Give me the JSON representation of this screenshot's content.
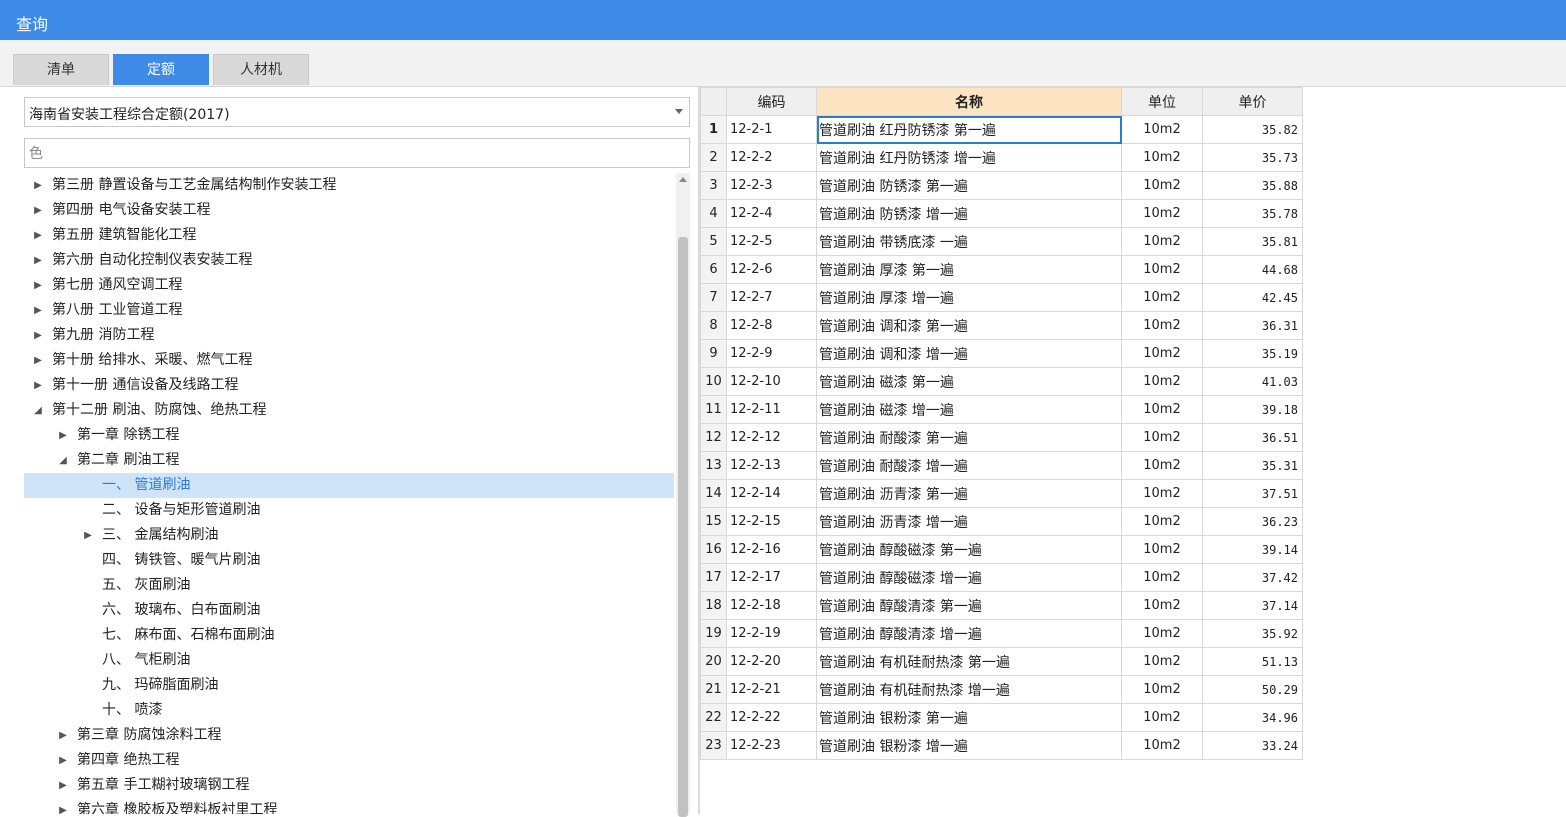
{
  "window": {
    "title": "查询"
  },
  "tabs": [
    {
      "label": "清单",
      "active": false
    },
    {
      "label": "定额",
      "active": true
    },
    {
      "label": "人材机",
      "active": false
    }
  ],
  "left": {
    "select_value": "海南省安装工程综合定额(2017)",
    "search_value": "色",
    "tree": [
      {
        "label": "第三册 静置设备与工艺金属结构制作安装工程",
        "level": 0,
        "arrow": "collapsed"
      },
      {
        "label": "第四册 电气设备安装工程",
        "level": 0,
        "arrow": "collapsed"
      },
      {
        "label": "第五册 建筑智能化工程",
        "level": 0,
        "arrow": "collapsed"
      },
      {
        "label": "第六册 自动化控制仪表安装工程",
        "level": 0,
        "arrow": "collapsed"
      },
      {
        "label": "第七册 通风空调工程",
        "level": 0,
        "arrow": "collapsed"
      },
      {
        "label": "第八册 工业管道工程",
        "level": 0,
        "arrow": "collapsed"
      },
      {
        "label": "第九册 消防工程",
        "level": 0,
        "arrow": "collapsed"
      },
      {
        "label": "第十册 给排水、采暖、燃气工程",
        "level": 0,
        "arrow": "collapsed"
      },
      {
        "label": "第十一册 通信设备及线路工程",
        "level": 0,
        "arrow": "collapsed"
      },
      {
        "label": "第十二册 刷油、防腐蚀、绝热工程",
        "level": 0,
        "arrow": "expanded"
      },
      {
        "label": "第一章 除锈工程",
        "level": 1,
        "arrow": "collapsed"
      },
      {
        "label": "第二章 刷油工程",
        "level": 1,
        "arrow": "expanded"
      },
      {
        "label": "一、 管道刷油",
        "level": 2,
        "arrow": "none",
        "selected": true
      },
      {
        "label": "二、 设备与矩形管道刷油",
        "level": 2,
        "arrow": "none"
      },
      {
        "label": "三、 金属结构刷油",
        "level": 2,
        "arrow": "collapsed"
      },
      {
        "label": "四、 铸铁管、暖气片刷油",
        "level": 2,
        "arrow": "none"
      },
      {
        "label": "五、 灰面刷油",
        "level": 2,
        "arrow": "none"
      },
      {
        "label": "六、 玻璃布、白布面刷油",
        "level": 2,
        "arrow": "none"
      },
      {
        "label": "七、 麻布面、石棉布面刷油",
        "level": 2,
        "arrow": "none"
      },
      {
        "label": "八、 气柜刷油",
        "level": 2,
        "arrow": "none"
      },
      {
        "label": "九、 玛碲脂面刷油",
        "level": 2,
        "arrow": "none"
      },
      {
        "label": "十、 喷漆",
        "level": 2,
        "arrow": "none"
      },
      {
        "label": "第三章 防腐蚀涂料工程",
        "level": 1,
        "arrow": "collapsed"
      },
      {
        "label": "第四章 绝热工程",
        "level": 1,
        "arrow": "collapsed"
      },
      {
        "label": "第五章 手工糊衬玻璃钢工程",
        "level": 1,
        "arrow": "collapsed"
      },
      {
        "label": "第六章 橡胶板及塑料板衬里工程",
        "level": 1,
        "arrow": "collapsed"
      }
    ]
  },
  "grid": {
    "headers": [
      "编码",
      "名称",
      "单位",
      "单价"
    ],
    "rows": [
      {
        "no": "1",
        "code": "12-2-1",
        "name": "管道刷油 红丹防锈漆 第一遍",
        "unit": "10m2",
        "price": "35.82"
      },
      {
        "no": "2",
        "code": "12-2-2",
        "name": "管道刷油 红丹防锈漆 增一遍",
        "unit": "10m2",
        "price": "35.73"
      },
      {
        "no": "3",
        "code": "12-2-3",
        "name": "管道刷油 防锈漆 第一遍",
        "unit": "10m2",
        "price": "35.88"
      },
      {
        "no": "4",
        "code": "12-2-4",
        "name": "管道刷油 防锈漆 增一遍",
        "unit": "10m2",
        "price": "35.78"
      },
      {
        "no": "5",
        "code": "12-2-5",
        "name": "管道刷油 带锈底漆 一遍",
        "unit": "10m2",
        "price": "35.81"
      },
      {
        "no": "6",
        "code": "12-2-6",
        "name": "管道刷油 厚漆 第一遍",
        "unit": "10m2",
        "price": "44.68"
      },
      {
        "no": "7",
        "code": "12-2-7",
        "name": "管道刷油 厚漆 增一遍",
        "unit": "10m2",
        "price": "42.45"
      },
      {
        "no": "8",
        "code": "12-2-8",
        "name": "管道刷油 调和漆 第一遍",
        "unit": "10m2",
        "price": "36.31"
      },
      {
        "no": "9",
        "code": "12-2-9",
        "name": "管道刷油 调和漆 增一遍",
        "unit": "10m2",
        "price": "35.19"
      },
      {
        "no": "10",
        "code": "12-2-10",
        "name": "管道刷油 磁漆 第一遍",
        "unit": "10m2",
        "price": "41.03"
      },
      {
        "no": "11",
        "code": "12-2-11",
        "name": "管道刷油 磁漆 增一遍",
        "unit": "10m2",
        "price": "39.18"
      },
      {
        "no": "12",
        "code": "12-2-12",
        "name": "管道刷油 耐酸漆 第一遍",
        "unit": "10m2",
        "price": "36.51"
      },
      {
        "no": "13",
        "code": "12-2-13",
        "name": "管道刷油 耐酸漆 增一遍",
        "unit": "10m2",
        "price": "35.31"
      },
      {
        "no": "14",
        "code": "12-2-14",
        "name": "管道刷油 沥青漆 第一遍",
        "unit": "10m2",
        "price": "37.51"
      },
      {
        "no": "15",
        "code": "12-2-15",
        "name": "管道刷油 沥青漆 增一遍",
        "unit": "10m2",
        "price": "36.23"
      },
      {
        "no": "16",
        "code": "12-2-16",
        "name": "管道刷油 醇酸磁漆 第一遍",
        "unit": "10m2",
        "price": "39.14"
      },
      {
        "no": "17",
        "code": "12-2-17",
        "name": "管道刷油 醇酸磁漆 增一遍",
        "unit": "10m2",
        "price": "37.42"
      },
      {
        "no": "18",
        "code": "12-2-18",
        "name": "管道刷油 醇酸清漆 第一遍",
        "unit": "10m2",
        "price": "37.14"
      },
      {
        "no": "19",
        "code": "12-2-19",
        "name": "管道刷油 醇酸清漆 增一遍",
        "unit": "10m2",
        "price": "35.92"
      },
      {
        "no": "20",
        "code": "12-2-20",
        "name": "管道刷油 有机硅耐热漆 第一遍",
        "unit": "10m2",
        "price": "51.13"
      },
      {
        "no": "21",
        "code": "12-2-21",
        "name": "管道刷油 有机硅耐热漆 增一遍",
        "unit": "10m2",
        "price": "50.29"
      },
      {
        "no": "22",
        "code": "12-2-22",
        "name": "管道刷油 银粉漆 第一遍",
        "unit": "10m2",
        "price": "34.96"
      },
      {
        "no": "23",
        "code": "12-2-23",
        "name": "管道刷油 银粉漆 增一遍",
        "unit": "10m2",
        "price": "33.24"
      }
    ]
  }
}
